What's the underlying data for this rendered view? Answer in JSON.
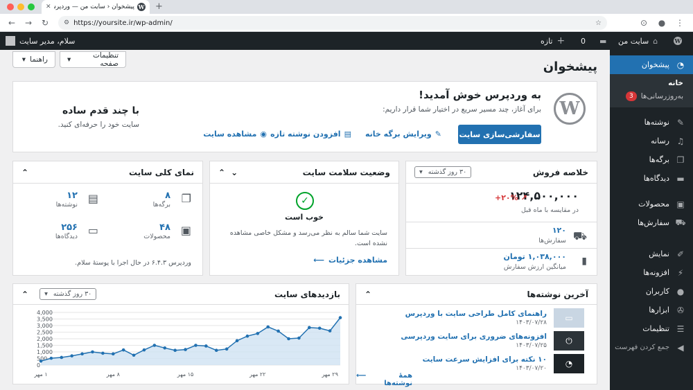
{
  "browser": {
    "tab_title": "پیشخوان ‹ سایت من — وردپرس",
    "url": "https://yoursite.ir/wp-admin/"
  },
  "adminbar": {
    "site_name": "سایت من",
    "comments_count": "0",
    "new_label": "تازه",
    "greeting": "سلام، مدیر سایت"
  },
  "sidebar": {
    "dashboard": "پیشخوان",
    "home": "خانه",
    "updates": "به‌روزرسانی‌ها",
    "updates_count": "3",
    "posts": "نوشته‌ها",
    "media": "رسانه",
    "pages": "برگه‌ها",
    "comments": "دیدگاه‌ها",
    "products": "محصولات",
    "orders": "سفارش‌ها",
    "appearance": "نمایش",
    "plugins": "افزونه‌ها",
    "users": "کاربران",
    "tools": "ابزارها",
    "settings": "تنظیمات",
    "collapse": "جمع کردن فهرست"
  },
  "header": {
    "title": "پیشخوان",
    "screen_options": "تنظیمات صفحه",
    "help": "راهنما"
  },
  "welcome": {
    "title": "به وردپرس خوش آمدید!",
    "subtitle": "برای آغاز، چند مسیر سریع در اختیار شما قرار داریم:",
    "customize_btn": "سفارشی‌سازی سایت",
    "edit_home": "ویرایش برگه خانه",
    "add_post": "افزودن نوشته تازه",
    "view_site": "مشاهده سایت",
    "side_title": "با چند قدم ساده",
    "side_text": "سایت خود را حرفه‌ای کنید."
  },
  "sales": {
    "title": "خلاصه فروش",
    "range": "۳۰ روز گذشته",
    "amount": "۱۲۴,۵۰۰,۰۰۰",
    "change": "+۲۰%",
    "compare": "در مقایسه با ماه قبل",
    "orders_value": "۱۲۰",
    "orders_label": "سفارش‌ها",
    "avg_value": "۱,۰۳۸,۰۰۰ تومان",
    "avg_label": "میانگین ارزش سفارش"
  },
  "health": {
    "title": "وضعیت سلامت سایت",
    "status": "خوب است",
    "text": "سایت شما سالم به نظر می‌رسد و مشکل خاصی مشاهده نشده است.",
    "details": "مشاهده جزئیات"
  },
  "glance": {
    "title": "نمای کلی سایت",
    "posts_count": "۱۲",
    "posts_label": "نوشته‌ها",
    "pages_count": "۸",
    "pages_label": "برگه‌ها",
    "comments_count": "۲۵۶",
    "comments_label": "دیدگاه‌ها",
    "products_count": "۴۸",
    "products_label": "محصولات",
    "footer": "وردپرس ۶.۴.۳ در حال اجرا با پوستهٔ سلام."
  },
  "visits": {
    "title": "بازدیدهای سایت",
    "range": "۳۰ روز گذشته"
  },
  "latest": {
    "title": "آخرین نوشته‌ها",
    "posts": [
      {
        "title": "راهنمای کامل طراحی سایت با وردپرس",
        "date": "۱۴۰۳/۰۷/۲۸"
      },
      {
        "title": "افزونه‌های ضروری برای سایت وردپرسی",
        "date": "۱۴۰۳/۰۷/۲۵"
      },
      {
        "title": "۱۰ نکته برای افزایش سرعت سایت",
        "date": "۱۴۰۳/۰۷/۲۰"
      }
    ],
    "all": "همهٔ نوشته‌ها"
  },
  "colors": {
    "accent": "#2271b1",
    "adminbar": "#1d2327",
    "success": "#00a32a",
    "up": "#d63638"
  },
  "chart_data": {
    "type": "area",
    "title": "بازدیدهای سایت",
    "x_ticks": [
      "۱ مهر",
      "۸ مهر",
      "۱۵ مهر",
      "۲۲ مهر",
      "۲۹ مهر"
    ],
    "y_ticks": [
      "0",
      "500",
      "1,000",
      "1,500",
      "2,000",
      "2,500",
      "3,000",
      "3,500",
      "4,000"
    ],
    "ylim": [
      0,
      4000
    ],
    "x": [
      1,
      2,
      3,
      4,
      5,
      6,
      7,
      8,
      9,
      10,
      11,
      12,
      13,
      14,
      15,
      16,
      17,
      18,
      19,
      20,
      21,
      22,
      23,
      24,
      25,
      26,
      27,
      28,
      29,
      30
    ],
    "values": [
      300,
      520,
      580,
      700,
      850,
      1000,
      900,
      850,
      1150,
      750,
      1150,
      1500,
      1300,
      1120,
      1180,
      1500,
      1450,
      1120,
      1220,
      1850,
      2200,
      2400,
      2900,
      2580,
      2000,
      2050,
      2850,
      2800,
      2600,
      3600
    ],
    "grid": true
  }
}
